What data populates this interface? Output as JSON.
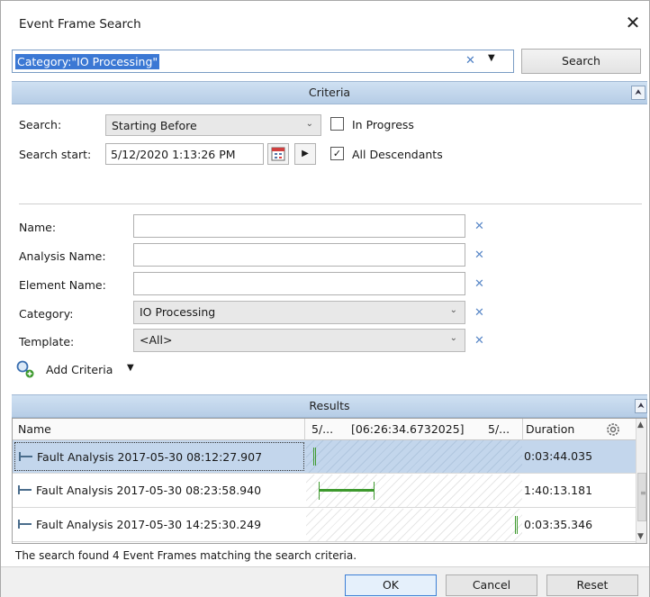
{
  "window": {
    "title": "Event Frame Search",
    "close": "✕"
  },
  "search": {
    "query": "Category:\"IO Processing\"",
    "button": "Search"
  },
  "criteria": {
    "header": "Criteria",
    "search_label": "Search:",
    "search_mode": "Starting Before",
    "in_progress_label": "In Progress",
    "in_progress_checked": false,
    "search_start_label": "Search start:",
    "search_start_value": "5/12/2020 1:13:26 PM",
    "all_descendants_label": "All Descendants",
    "all_descendants_checked": true,
    "fields": [
      {
        "label": "Name:",
        "value": ""
      },
      {
        "label": "Analysis Name:",
        "value": ""
      },
      {
        "label": "Element Name:",
        "value": ""
      },
      {
        "label": "Category:",
        "value": "IO Processing"
      },
      {
        "label": "Template:",
        "value": "<All>"
      }
    ],
    "add_criteria": "Add Criteria"
  },
  "results": {
    "header": "Results",
    "columns": {
      "name": "Name",
      "t1": "5/...",
      "t2": "[06:26:34.6732025]",
      "t3": "5/...",
      "duration": "Duration"
    },
    "rows": [
      {
        "name": "Fault Analysis 2017-05-30 08:12:27.907",
        "duration": "0:03:44.035",
        "selected": true
      },
      {
        "name": "Fault Analysis 2017-05-30 08:23:58.940",
        "duration": "1:40:13.181",
        "selected": false
      },
      {
        "name": "Fault Analysis 2017-05-30 14:25:30.249",
        "duration": "0:03:35.346",
        "selected": false
      }
    ],
    "status": "The search found 4 Event Frames matching the search criteria."
  },
  "buttons": {
    "ok": "OK",
    "cancel": "Cancel",
    "reset": "Reset"
  },
  "colors": {
    "accent": "#3b78d4",
    "header_bg": "#c4d8ee",
    "bar_green": "#3e9a2e"
  }
}
